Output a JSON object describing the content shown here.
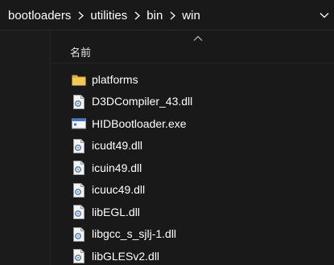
{
  "breadcrumb": {
    "items": [
      "bootloaders",
      "utilities",
      "bin",
      "win"
    ]
  },
  "columns": {
    "name_label": "名前"
  },
  "files": [
    {
      "name": "platforms",
      "icon": "folder-icon"
    },
    {
      "name": "D3DCompiler_43.dll",
      "icon": "dll-file-icon"
    },
    {
      "name": "HIDBootloader.exe",
      "icon": "exe-file-icon"
    },
    {
      "name": "icudt49.dll",
      "icon": "dll-file-icon"
    },
    {
      "name": "icuin49.dll",
      "icon": "dll-file-icon"
    },
    {
      "name": "icuuc49.dll",
      "icon": "dll-file-icon"
    },
    {
      "name": "libEGL.dll",
      "icon": "dll-file-icon"
    },
    {
      "name": "libgcc_s_sjlj-1.dll",
      "icon": "dll-file-icon"
    },
    {
      "name": "libGLESv2.dll",
      "icon": "dll-file-icon"
    }
  ],
  "colors": {
    "background": "#191919",
    "text": "#ffffff",
    "folder": "#f0c24e",
    "exe_titlebar": "#3c78d8"
  }
}
